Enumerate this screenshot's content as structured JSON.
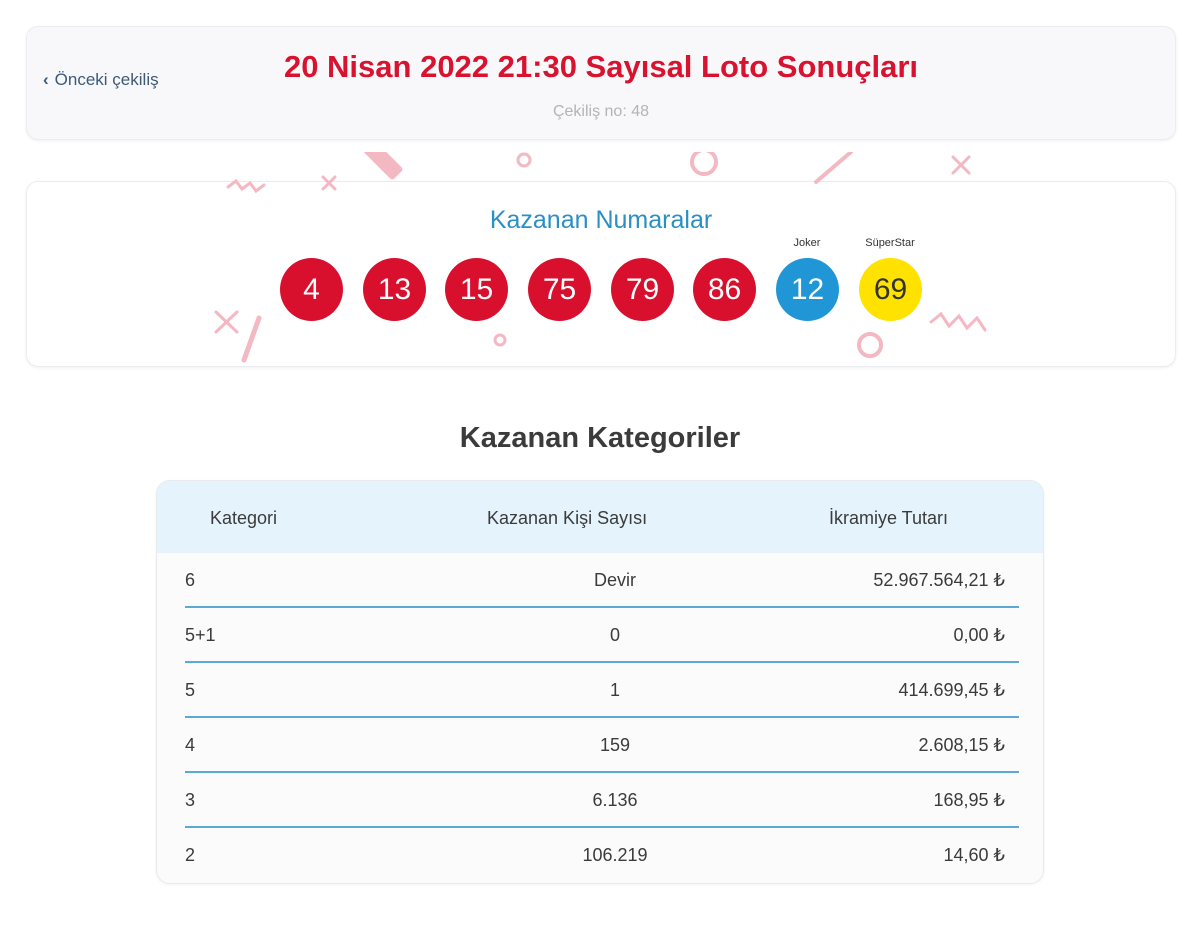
{
  "header": {
    "prev_label": "Önceki çekiliş",
    "title": "20 Nisan 2022 21:30 Sayısal Loto Sonuçları",
    "draw_no": "Çekiliş no: 48"
  },
  "numbers": {
    "title": "Kazanan Numaralar",
    "main": [
      "4",
      "13",
      "15",
      "75",
      "79",
      "86"
    ],
    "joker_label": "Joker",
    "joker": "12",
    "superstar_label": "SüperStar",
    "superstar": "69"
  },
  "categories": {
    "title": "Kazanan Kategoriler",
    "headers": [
      "Kategori",
      "Kazanan Kişi Sayısı",
      "İkramiye Tutarı"
    ],
    "rows": [
      {
        "category": "6",
        "winners": "Devir",
        "amount": "52.967.564,21 ₺"
      },
      {
        "category": "5+1",
        "winners": "0",
        "amount": "0,00 ₺"
      },
      {
        "category": "5",
        "winners": "1",
        "amount": "414.699,45 ₺"
      },
      {
        "category": "4",
        "winners": "159",
        "amount": "2.608,15 ₺"
      },
      {
        "category": "3",
        "winners": "6.136",
        "amount": "168,95 ₺"
      },
      {
        "category": "2",
        "winners": "106.219",
        "amount": "14,60 ₺"
      }
    ]
  },
  "colors": {
    "title_red": "#d8122f",
    "ball_red": "#d8102e",
    "joker_blue": "#2196d6",
    "superstar_yellow": "#ffe200",
    "accent_blue": "#2a8fc4"
  }
}
